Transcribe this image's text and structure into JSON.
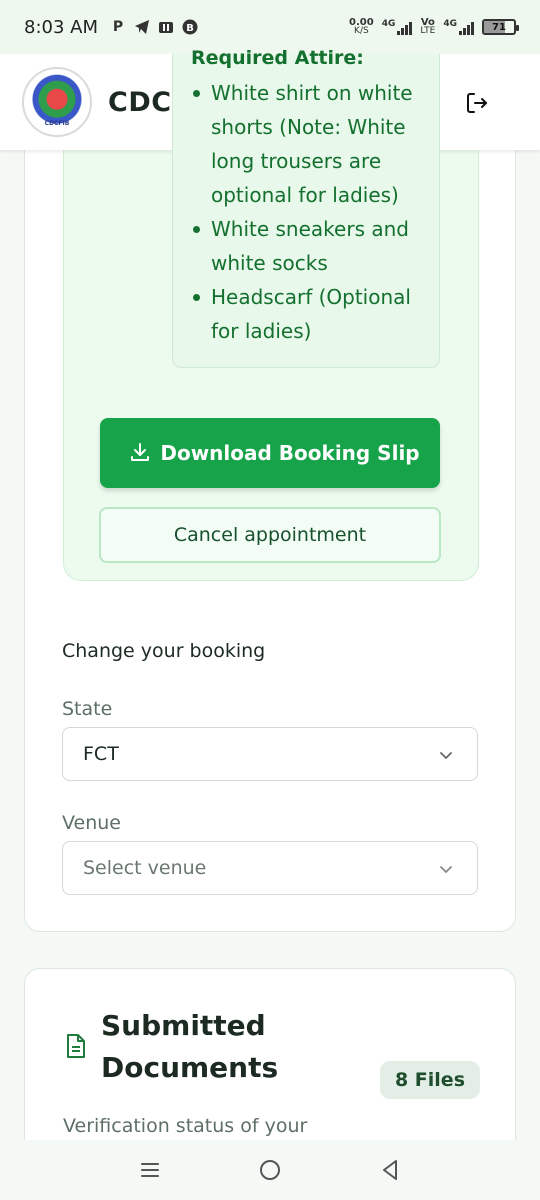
{
  "status_bar": {
    "time": "8:03 AM",
    "net_speed_value": "0.00",
    "net_speed_unit": "K/S",
    "sim1_label": "4G",
    "volte_top": "Vo",
    "volte_bottom": "LTE",
    "sim2_label": "4G",
    "battery_level": "71"
  },
  "header": {
    "brand": "CDCFIB",
    "logo_text": "CDCFIB"
  },
  "attire": {
    "title": "Required Attire:",
    "items": [
      "White shirt on white shorts (Note: White long trousers are optional for ladies)",
      "White sneakers and white socks",
      "Headscarf (Optional for ladies)"
    ]
  },
  "booking": {
    "download_label": "Download Booking Slip",
    "cancel_label": "Cancel appointment",
    "change_title": "Change your booking",
    "state_label": "State",
    "state_value": "FCT",
    "venue_label": "Venue",
    "venue_placeholder": "Select venue"
  },
  "documents": {
    "title": "Submitted Documents",
    "badge": "8 Files",
    "subtitle": "Verification status of your uploaded credentials"
  },
  "colors": {
    "primary_green": "#16a34a",
    "light_green": "#edfbef",
    "dark_text": "#1c2a22"
  }
}
